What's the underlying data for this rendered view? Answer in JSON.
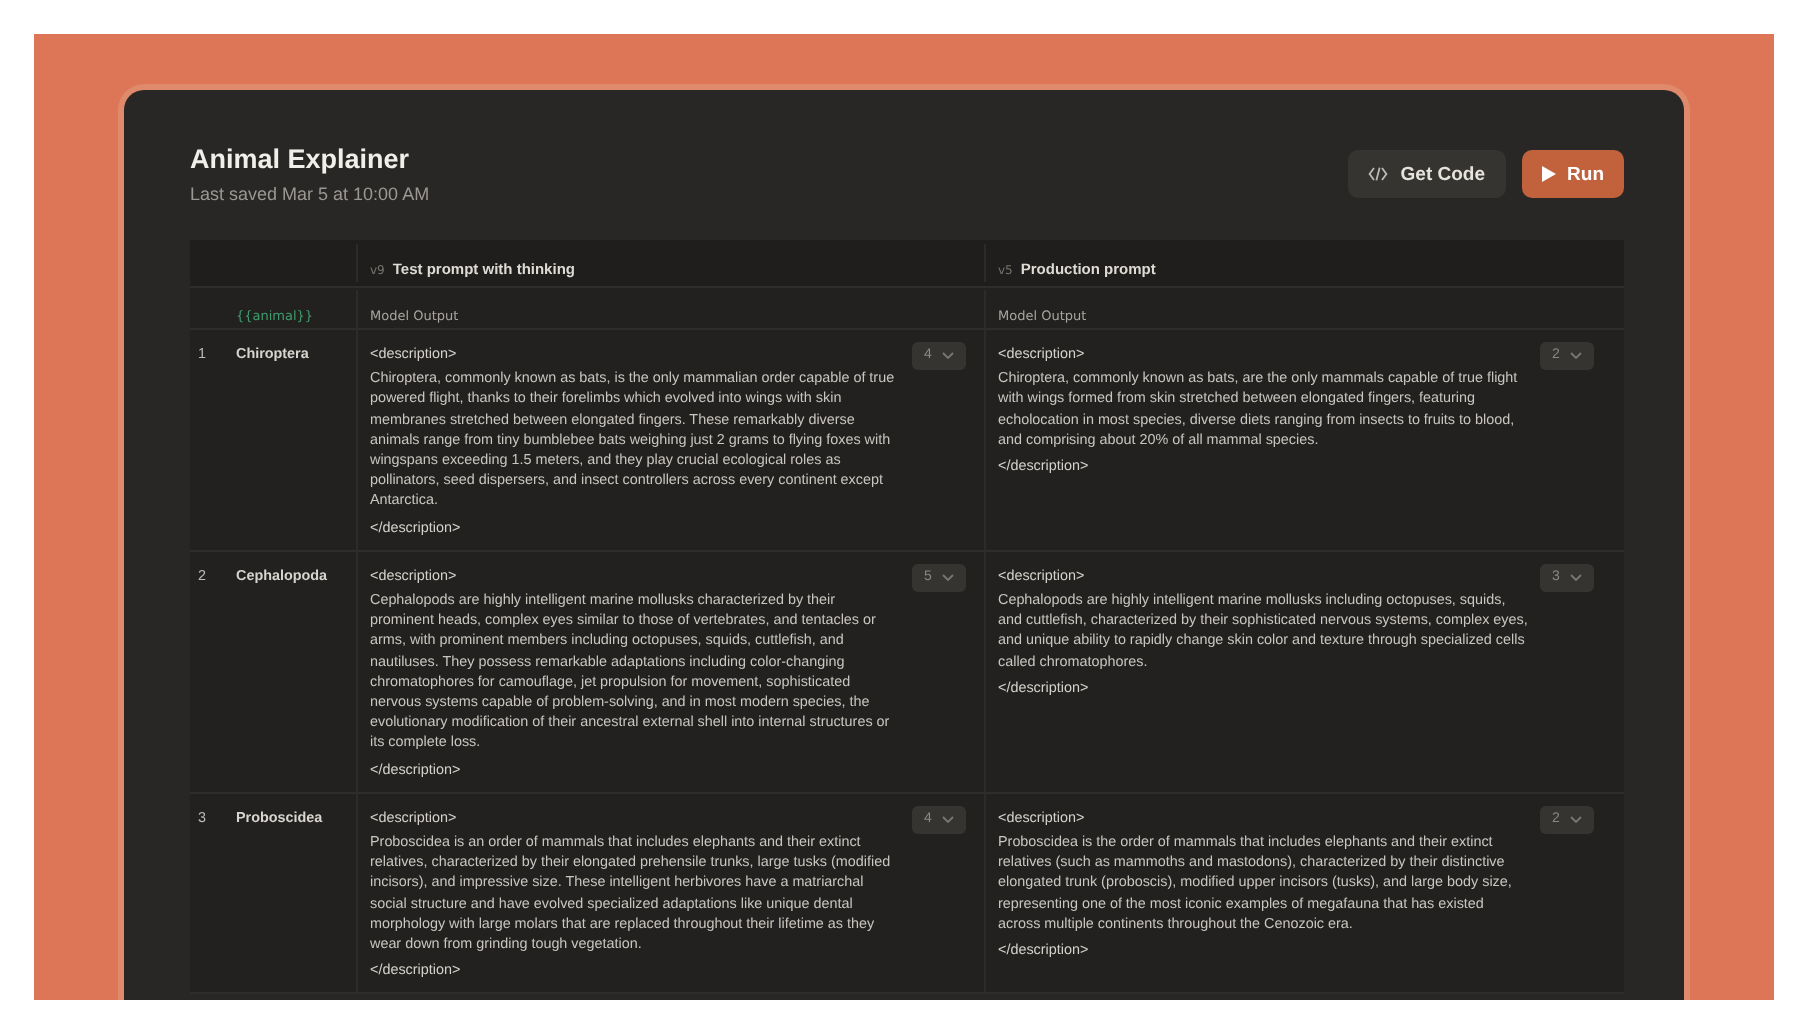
{
  "window": {
    "title": "Animal Explainer",
    "subtitle": "Last saved Mar 5 at 10:00 AM"
  },
  "buttons": [
    {
      "kind": "code",
      "label": "Get Code"
    },
    {
      "kind": "run",
      "label": "Run"
    }
  ],
  "table": {
    "variable": "{{animal}}",
    "prompts": [
      {
        "version": "v9",
        "name": "Test prompt with thinking",
        "output_label": "Model Output"
      },
      {
        "version": "v5",
        "name": "Production prompt",
        "output_label": "Model Output"
      }
    ],
    "rows": [
      {
        "number": "1",
        "name": "Chiroptera",
        "outputs": [
          {
            "open": "<description>",
            "text": "Chiroptera, commonly known as bats, is the only mammalian order capable of true powered flight, thanks to their forelimbs which evolved into wings with skin membranes stretched between elongated fingers. These remarkably diverse animals range from tiny bumblebee bats weighing just 2 grams to flying foxes with wingspans exceeding 1.5 meters, and they play crucial ecological roles as pollinators, seed dispersers, and insect controllers across every continent except Antarctica.",
            "close": "</description>",
            "score": "4"
          },
          {
            "open": "<description>",
            "text": "Chiroptera, commonly known as bats, are the only mammals capable of true flight with wings formed from skin stretched between elongated fingers, featuring echolocation in most species, diverse diets ranging from insects to fruits to blood, and comprising about 20% of all mammal species.",
            "close": "</description>",
            "score": "2"
          }
        ]
      },
      {
        "number": "2",
        "name": "Cephalopoda",
        "outputs": [
          {
            "open": "<description>",
            "text": "Cephalopods are highly intelligent marine mollusks characterized by their prominent heads, complex eyes similar to those of vertebrates, and tentacles or arms, with prominent members including octopuses, squids, cuttlefish, and nautiluses. They possess remarkable adaptations including color-changing chromatophores for camouflage, jet propulsion for movement, sophisticated nervous systems capable of problem-solving, and in most modern species, the evolutionary modification of their ancestral external shell into internal structures or its complete loss.",
            "close": "</description>",
            "score": "5"
          },
          {
            "open": "<description>",
            "text": "Cephalopods are highly intelligent marine mollusks including octopuses, squids, and cuttlefish, characterized by their sophisticated nervous systems, complex eyes, and unique ability to rapidly change skin color and texture through specialized cells called chromatophores.",
            "close": "</description>",
            "score": "3"
          }
        ]
      },
      {
        "number": "3",
        "name": "Proboscidea",
        "outputs": [
          {
            "open": "<description>",
            "text": "Proboscidea is an order of mammals that includes elephants and their extinct relatives, characterized by their elongated prehensile trunks, large tusks (modified incisors), and impressive size. These intelligent herbivores have a matriarchal social structure and have evolved specialized adaptations like unique dental morphology with large molars that are replaced throughout their lifetime as they wear down from grinding tough vegetation.",
            "close": "</description>",
            "score": "4"
          },
          {
            "open": "<description>",
            "text": "Proboscidea is the order of mammals that includes elephants and their extinct relatives (such as mammoths and mastodons), characterized by their distinctive elongated trunk (proboscis), modified upper incisors (tusks), and large body size, representing one of the most iconic examples of megafauna that has existed across multiple continents throughout the Cenozoic era.",
            "close": "</description>",
            "score": "2"
          }
        ]
      }
    ]
  }
}
